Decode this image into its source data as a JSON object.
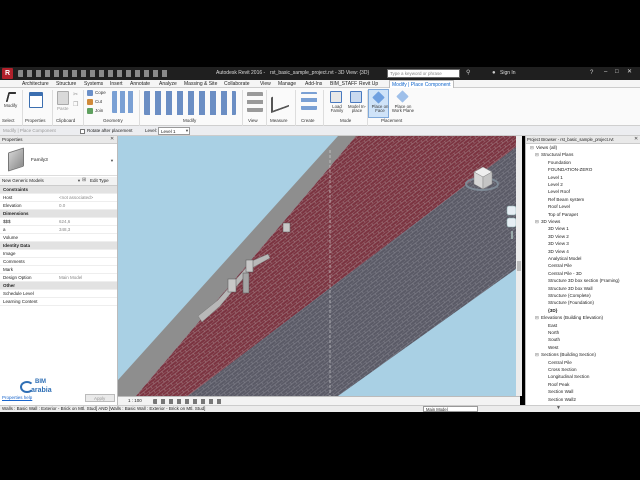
{
  "title_bar": {
    "app_title": "Autodesk Revit 2016 -",
    "file_title": "rst_basic_sample_project.rvt - 3D View: {3D}",
    "search_placeholder": "Type a keyword or phrase",
    "sign_in": "Sign In"
  },
  "ribbon_tabs": [
    "Architecture",
    "Structure",
    "Systems",
    "Insert",
    "Annotate",
    "Analyze",
    "Massing & Site",
    "Collaborate",
    "View",
    "Manage",
    "Add-Ins",
    "BIM_STAFF",
    "Revit Up",
    "Modify | Place Component"
  ],
  "ribbon": {
    "select_label": "Select",
    "properties_label": "Properties",
    "modify_label": "Modify",
    "paste_label": "Paste",
    "clipboard_label": "Clipboard",
    "cope_label": "Cope",
    "cut_label": "Cut",
    "join_label": "Join",
    "geometry_label": "Geometry",
    "modify_panel_label": "Modify",
    "view_label": "View",
    "measure_label": "Measure",
    "create_label": "Create",
    "load_family_label": "Load Family",
    "model_in_place_label": "Model In-place",
    "mode_label": "Mode",
    "place_on_face_label": "Place on Face",
    "place_on_work_plane_label": "Place on Work Plane",
    "placement_label": "Placement"
  },
  "options_bar": {
    "context": "Modify | Place Component",
    "rotate_after_placement": "Rotate after placement",
    "level_label": "Level:",
    "level_value": "Level 1"
  },
  "properties": {
    "header": "Properties",
    "family_name": "Family3",
    "type_selector": "New Generic Models",
    "edit_type": "Edit Type",
    "rows": [
      {
        "k": "Constraints",
        "v": "",
        "group": true
      },
      {
        "k": "Host",
        "v": "<not associated>"
      },
      {
        "k": "Elevation",
        "v": "0.0"
      },
      {
        "k": "Dimensions",
        "v": "",
        "group": true
      },
      {
        "k": "$$$",
        "v": "624,6"
      },
      {
        "k": "a",
        "v": "348,3"
      },
      {
        "k": "Volume",
        "v": ""
      },
      {
        "k": "Identity Data",
        "v": "",
        "group": true
      },
      {
        "k": "Image",
        "v": ""
      },
      {
        "k": "Comments",
        "v": ""
      },
      {
        "k": "Mark",
        "v": ""
      },
      {
        "k": "Design Option",
        "v": "Main Model"
      },
      {
        "k": "Other",
        "v": "",
        "group": true
      },
      {
        "k": "Schedule Level",
        "v": ""
      },
      {
        "k": "Learning Content",
        "v": ""
      }
    ],
    "help_link": "Properties help",
    "apply_button": "Apply",
    "logo_bim": "BIM",
    "logo_arabia": "arabia"
  },
  "view_bar": {
    "scale": "1 : 100"
  },
  "project_browser": {
    "header": "Project Browser - rst_basic_sample_project.rvt",
    "items": [
      {
        "text": "Views (all)",
        "level": 0,
        "expand": "-"
      },
      {
        "text": "Structural Plans",
        "level": 1,
        "expand": "-"
      },
      {
        "text": "Foundation",
        "level": 2
      },
      {
        "text": "FOUNDATION-ZERO",
        "level": 2
      },
      {
        "text": "Level 1",
        "level": 2
      },
      {
        "text": "Level 2",
        "level": 2
      },
      {
        "text": "Level Roof",
        "level": 2
      },
      {
        "text": "Ref Beam system",
        "level": 2
      },
      {
        "text": "Roof Level",
        "level": 2
      },
      {
        "text": "Top of Parapet",
        "level": 2
      },
      {
        "text": "3D Views",
        "level": 1,
        "expand": "-"
      },
      {
        "text": "3D View 1",
        "level": 2
      },
      {
        "text": "3D View 2",
        "level": 2
      },
      {
        "text": "3D View 3",
        "level": 2
      },
      {
        "text": "3D View 4",
        "level": 2
      },
      {
        "text": "Analytical Model",
        "level": 2
      },
      {
        "text": "Central Pile",
        "level": 2
      },
      {
        "text": "Central Pile - 3D",
        "level": 2
      },
      {
        "text": "Structure 3D box section (Framing)",
        "level": 2
      },
      {
        "text": "Structure 3D box Wall",
        "level": 2
      },
      {
        "text": "Structure (Complete)",
        "level": 2
      },
      {
        "text": "Structure (Foundation)",
        "level": 2
      },
      {
        "text": "{3D}",
        "level": 2,
        "bold": true
      },
      {
        "text": "Elevations (Building Elevation)",
        "level": 1,
        "expand": "-"
      },
      {
        "text": "East",
        "level": 2
      },
      {
        "text": "North",
        "level": 2
      },
      {
        "text": "South",
        "level": 2
      },
      {
        "text": "West",
        "level": 2
      },
      {
        "text": "Sections (Building Section)",
        "level": 1,
        "expand": "-"
      },
      {
        "text": "Central Pile",
        "level": 2
      },
      {
        "text": "Cross Section",
        "level": 2
      },
      {
        "text": "Longitudinal Section",
        "level": 2
      },
      {
        "text": "Roof Peak",
        "level": 2
      },
      {
        "text": "Section Wall",
        "level": 2
      },
      {
        "text": "Section Wall2",
        "level": 2
      }
    ]
  },
  "status_bar": {
    "text": "Walls : Basic Wall : Exterior - Brick on Mtl. Stud] AND [Walls : Basic Wall : Exterior - Brick on Mtl. Stud]",
    "model": "Main Model"
  },
  "colors": {
    "view_bg": "#a9d0e4",
    "brick": "#7b3340",
    "stone": "#5a5a66",
    "accent": "#1a66cc"
  }
}
